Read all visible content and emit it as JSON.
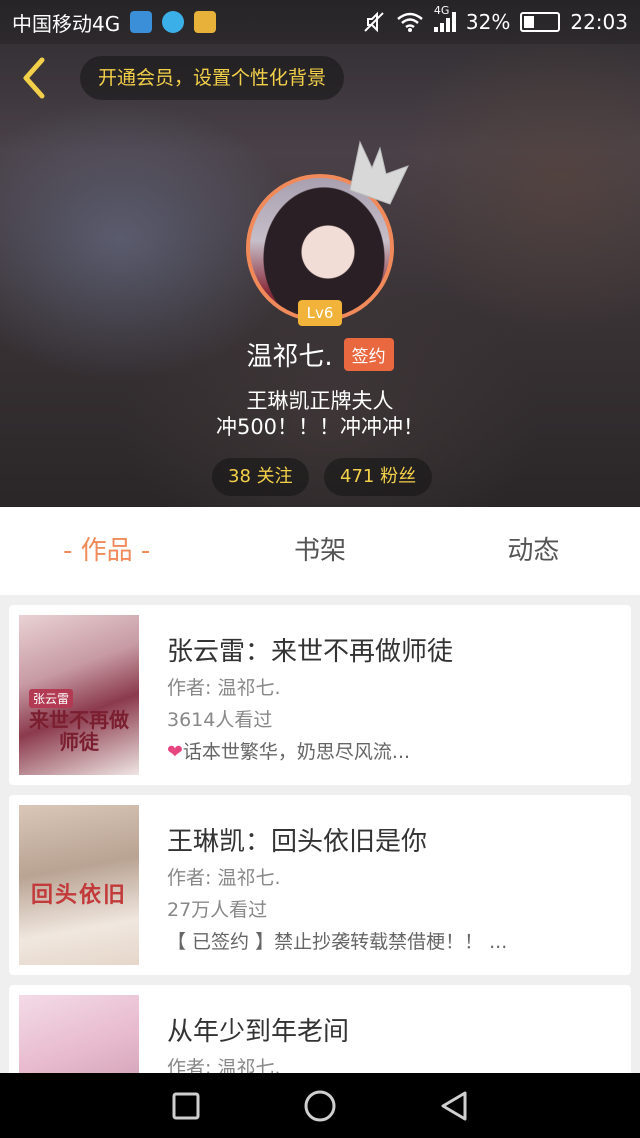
{
  "status_bar": {
    "carrier": "中国移动4G",
    "network": "4G",
    "battery": "32%",
    "battery_level": 0.32,
    "time": "22:03",
    "app_icons": [
      "map-app-icon",
      "message-app-icon",
      "weibo-app-icon"
    ]
  },
  "header": {
    "back_icon": "chevron-left-icon",
    "member_prompt": "开通会员，设置个性化背景"
  },
  "profile": {
    "level": "Lv6",
    "name": "温祁七.",
    "sign_badge": "签约",
    "bio_line1": "王琳凯正牌夫人",
    "bio_line2": "冲500！！！冲冲冲！",
    "following": "38 关注",
    "fans": "471 粉丝"
  },
  "tabs": [
    {
      "label": "- 作品 -",
      "active": true
    },
    {
      "label": "书架",
      "active": false
    },
    {
      "label": "动态",
      "active": false
    }
  ],
  "works": [
    {
      "title": "张云雷：来世不再做师徒",
      "author": "作者: 温祁七.",
      "views": "3614人看过",
      "desc": "话本世繁华，奶思尽风流...",
      "desc_prefix_icon": "heart-icon",
      "cover_text": "来世不再做师徒",
      "cover_tag": "张云雷"
    },
    {
      "title": "王琳凯：回头依旧是你",
      "author": "作者: 温祁七.",
      "views": "27万人看过",
      "desc": "【 已签约 】禁止抄袭转载禁借梗！！ ...",
      "cover_text": "回头依旧"
    },
    {
      "title": "从年少到年老间",
      "author": "作者: 温祁七."
    }
  ],
  "colors": {
    "accent": "#f08a5a",
    "gold_text": "#f3d04a",
    "sign_badge": "#e9683f",
    "level_badge": "#f2b33a"
  },
  "nav_bar": [
    "square-recent-icon",
    "circle-home-icon",
    "triangle-back-icon"
  ]
}
